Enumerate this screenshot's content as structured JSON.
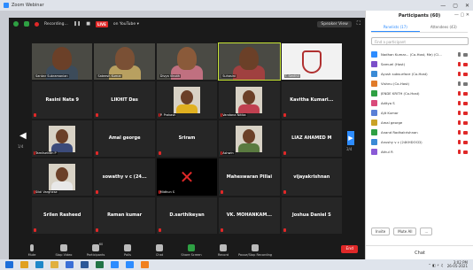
{
  "window": {
    "title": "Zoom Webinar",
    "controls": [
      "—",
      "▢",
      "✕"
    ]
  },
  "topbar": {
    "recording_label": "Recording...",
    "pause": "❚❚",
    "stop": "■",
    "live_badge": "LIVE",
    "live_label": "on YouTube ▾",
    "view_button": "Speaker View",
    "fullscreen": "⛶"
  },
  "grid": {
    "page_left": "1/4",
    "page_right": "3/4",
    "tiles": [
      {
        "kind": "video",
        "label": "Sankar Subramanian",
        "skin": "#6b4028",
        "shirt": "#3c4b5a"
      },
      {
        "kind": "video",
        "label": "Sateesh Kumar",
        "skin": "#7a5035",
        "shirt": "#b8a060"
      },
      {
        "kind": "video",
        "label": "Divya Vinoth",
        "skin": "#8a5a3a",
        "shirt": "#c07080"
      },
      {
        "kind": "video",
        "label": "Suhasini",
        "skin": "#6b4028",
        "shirt": "#a04040",
        "active": true
      },
      {
        "kind": "logo",
        "label": "T. Senthil",
        "logo_color": "#b03030"
      },
      {
        "kind": "name",
        "name": "Rasini Nata 9"
      },
      {
        "kind": "name",
        "name": "LIKHIT Das"
      },
      {
        "kind": "pic",
        "label": "P. Prakash",
        "shirt": "#e0b020"
      },
      {
        "kind": "pic",
        "label": "Vandana Nitika",
        "shirt": "#c04050"
      },
      {
        "kind": "name",
        "name": "Kavitha Kumari..."
      },
      {
        "kind": "pic",
        "label": "Tamilselvan P",
        "shirt": "#3c4b7a"
      },
      {
        "kind": "name",
        "name": "Amal george"
      },
      {
        "kind": "name",
        "name": "Sriram"
      },
      {
        "kind": "pic",
        "label": "Ashwin",
        "shirt": "#5a7a40"
      },
      {
        "kind": "name",
        "name": "LIAZ AHAMED M"
      },
      {
        "kind": "pic",
        "label": "Sibil Varghese",
        "shirt": "#e8e8e8"
      },
      {
        "kind": "name",
        "name": "sowathy v c (24..."
      },
      {
        "kind": "art",
        "label": "Midhun S"
      },
      {
        "kind": "name",
        "name": "Maheswaran Pillai"
      },
      {
        "kind": "name",
        "name": "vijayakrishnan"
      },
      {
        "kind": "name",
        "name": "Srilen Rasheed"
      },
      {
        "kind": "name",
        "name": "Raman kumar"
      },
      {
        "kind": "name",
        "name": "D.sarthikeyan"
      },
      {
        "kind": "name",
        "name": "VK. MOHANKAM..."
      },
      {
        "kind": "name",
        "name": "Joshua Daniel S"
      }
    ]
  },
  "toolbar": {
    "buttons": [
      {
        "label": "Mute",
        "icon": "mic"
      },
      {
        "label": "Stop Video",
        "icon": "camera"
      },
      {
        "label": "Participants",
        "icon": "people",
        "count": "60"
      },
      {
        "label": "Polls",
        "icon": "poll"
      },
      {
        "label": "Chat",
        "icon": "chat"
      },
      {
        "label": "Share Screen",
        "icon": "share",
        "green": true
      },
      {
        "label": "Record",
        "icon": "record"
      },
      {
        "label": "Pause/Stop Recording",
        "icon": "pause-rec"
      }
    ],
    "end": "End"
  },
  "panel": {
    "title": "Participants (60)",
    "tabs": [
      "Panelists (17)",
      "Attendees (43)"
    ],
    "search_placeholder": "Find a participant",
    "participants": [
      {
        "name": "Nadhan Kumar... (Co-Host, Me) (Cl...",
        "color": "#2d8cff",
        "mic_on": true,
        "cam_on": true
      },
      {
        "name": "Samuel (Host)",
        "color": "#7b4fc9",
        "mic_on": false,
        "cam_on": false
      },
      {
        "name": "Ayush subsurface (Co-Host)",
        "color": "#3a8ad6",
        "mic_on": false,
        "cam_on": false
      },
      {
        "name": "Vishnu (Co-Host)",
        "color": "#e07b2a",
        "mic_on": true,
        "cam_on": true
      },
      {
        "name": "JENDE KRITH (Co-Host)",
        "color": "#2ea043",
        "mic_on": false,
        "cam_on": false
      },
      {
        "name": "Aditya S",
        "color": "#d94a7a",
        "mic_on": false,
        "cam_on": false
      },
      {
        "name": "Ajit Kumar",
        "color": "#5a7fd6",
        "mic_on": false,
        "cam_on": false
      },
      {
        "name": "Amal george",
        "color": "#c9a227",
        "mic_on": false,
        "cam_on": false
      },
      {
        "name": "Anand Radhakrishnan",
        "color": "#2ea043",
        "mic_on": false,
        "cam_on": false
      },
      {
        "name": "Anushy v c (24KHDOCD)",
        "color": "#3a8ad6",
        "mic_on": false,
        "cam_on": false
      },
      {
        "name": "Athul R",
        "color": "#8a5ad6",
        "mic_on": false,
        "cam_on": false
      }
    ],
    "bottom_buttons": [
      "Invite",
      "Mute All",
      "..."
    ],
    "chat_label": "Chat"
  },
  "taskbar": {
    "apps": [
      {
        "icon": "windows-start-icon",
        "color": "#1e6fd9"
      },
      {
        "icon": "chrome-icon",
        "color": "#e0a020"
      },
      {
        "icon": "edge-icon",
        "color": "#1e88c9"
      },
      {
        "icon": "explorer-icon",
        "color": "#e0b040"
      },
      {
        "icon": "store-icon",
        "color": "#3a6fd6"
      },
      {
        "icon": "word-icon",
        "color": "#2b5797"
      },
      {
        "icon": "excel-icon",
        "color": "#217346"
      },
      {
        "icon": "photos-icon",
        "color": "#2d8cff"
      },
      {
        "icon": "zoom-icon",
        "color": "#2d8cff"
      },
      {
        "icon": "vlc-icon",
        "color": "#f08020"
      }
    ],
    "tray_icons": "⌃ ◧ ⚡ ♫",
    "time": "3:02 PM",
    "date": "26-05-2021"
  }
}
